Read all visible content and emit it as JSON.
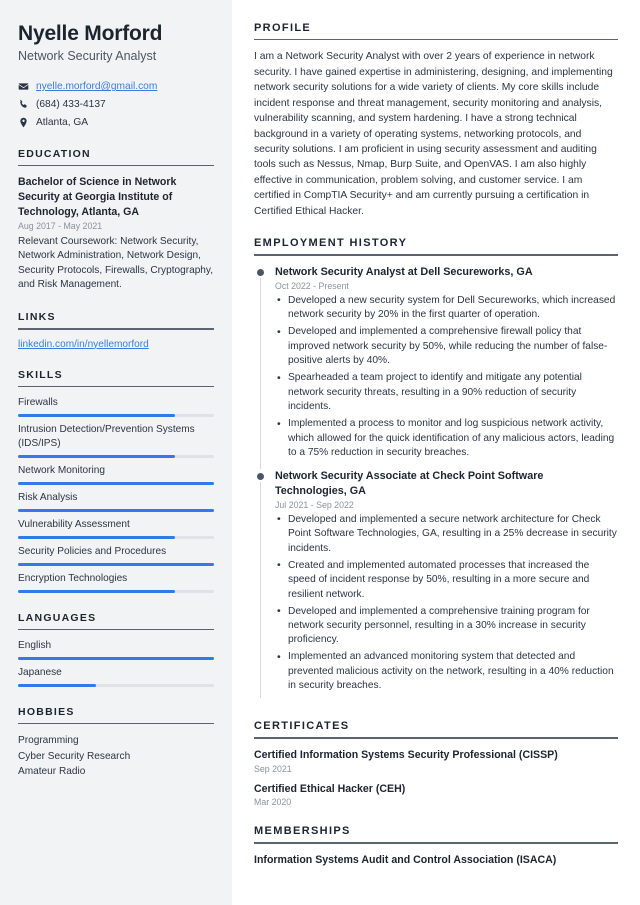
{
  "colors": {
    "accent": "#3479ea",
    "link": "#3b7ae0",
    "sidebar_bg": "#f2f3f5",
    "heading": "#1c2430",
    "muted": "#8b919c"
  },
  "sidebar": {
    "name": "Nyelle Morford",
    "job_title": "Network Security Analyst",
    "contact": [
      {
        "icon": "envelope-icon",
        "text": "nyelle.morford@gmail.com",
        "is_link": true
      },
      {
        "icon": "phone-icon",
        "text": "(684) 433-4137",
        "is_link": false
      },
      {
        "icon": "location-pin-icon",
        "text": "Atlanta, GA",
        "is_link": false
      }
    ],
    "education": {
      "title": "EDUCATION",
      "degree": "Bachelor of Science in Network Security at Georgia Institute of Technology, Atlanta, GA",
      "date": "Aug 2017 - May 2021",
      "description": "Relevant Coursework: Network Security, Network Administration, Network Design, Security Protocols, Firewalls, Cryptography, and Risk Management."
    },
    "links": {
      "title": "LINKS",
      "items": [
        {
          "label": "linkedin.com/in/nyellemorford"
        }
      ]
    },
    "skills": {
      "title": "SKILLS",
      "items": [
        {
          "label": "Firewalls",
          "level": 80
        },
        {
          "label": "Intrusion Detection/Prevention Systems (IDS/IPS)",
          "level": 80
        },
        {
          "label": "Network Monitoring",
          "level": 100
        },
        {
          "label": "Risk Analysis",
          "level": 100
        },
        {
          "label": "Vulnerability Assessment",
          "level": 80
        },
        {
          "label": "Security Policies and Procedures",
          "level": 100
        },
        {
          "label": "Encryption Technologies",
          "level": 80
        }
      ]
    },
    "languages": {
      "title": "LANGUAGES",
      "items": [
        {
          "label": "English",
          "level": 100
        },
        {
          "label": "Japanese",
          "level": 40
        }
      ]
    },
    "hobbies": {
      "title": "HOBBIES",
      "items": [
        {
          "label": "Programming"
        },
        {
          "label": "Cyber Security Research"
        },
        {
          "label": "Amateur Radio"
        }
      ]
    }
  },
  "main": {
    "profile": {
      "title": "PROFILE",
      "text": "I am a Network Security Analyst with over 2 years of experience in network security. I have gained expertise in administering, designing, and implementing network security solutions for a wide variety of clients. My core skills include incident response and threat management, security monitoring and analysis, vulnerability scanning, and system hardening. I have a strong technical background in a variety of operating systems, networking protocols, and security solutions. I am proficient in using security assessment and auditing tools such as Nessus, Nmap, Burp Suite, and OpenVAS. I am also highly effective in communication, problem solving, and customer service. I am certified in CompTIA Security+ and am currently pursuing a certification in Certified Ethical Hacker."
    },
    "employment": {
      "title": "EMPLOYMENT HISTORY",
      "jobs": [
        {
          "heading": "Network Security Analyst at Dell Secureworks, GA",
          "date": "Oct 2022 - Present",
          "bullets": [
            "Developed a new security system for Dell Secureworks, which increased network security by 20% in the first quarter of operation.",
            "Developed and implemented a comprehensive firewall policy that improved network security by 50%, while reducing the number of false-positive alerts by 40%.",
            "Spearheaded a team project to identify and mitigate any potential network security threats, resulting in a 90% reduction of security incidents.",
            "Implemented a process to monitor and log suspicious network activity, which allowed for the quick identification of any malicious actors, leading to a 75% reduction in security breaches."
          ]
        },
        {
          "heading": "Network Security Associate at Check Point Software Technologies, GA",
          "date": "Jul 2021 - Sep 2022",
          "bullets": [
            "Developed and implemented a secure network architecture for Check Point Software Technologies, GA, resulting in a 25% decrease in security incidents.",
            "Created and implemented automated processes that increased the speed of incident response by 50%, resulting in a more secure and resilient network.",
            "Developed and implemented a comprehensive training program for network security personnel, resulting in a 30% increase in security proficiency.",
            "Implemented an advanced monitoring system that detected and prevented malicious activity on the network, resulting in a 40% reduction in security breaches."
          ]
        }
      ]
    },
    "certificates": {
      "title": "CERTIFICATES",
      "items": [
        {
          "name": "Certified Information Systems Security Professional (CISSP)",
          "date": "Sep 2021"
        },
        {
          "name": "Certified Ethical Hacker (CEH)",
          "date": "Mar 2020"
        }
      ]
    },
    "memberships": {
      "title": "MEMBERSHIPS",
      "items": [
        {
          "name": "Information Systems Audit and Control Association (ISACA)"
        }
      ]
    }
  }
}
